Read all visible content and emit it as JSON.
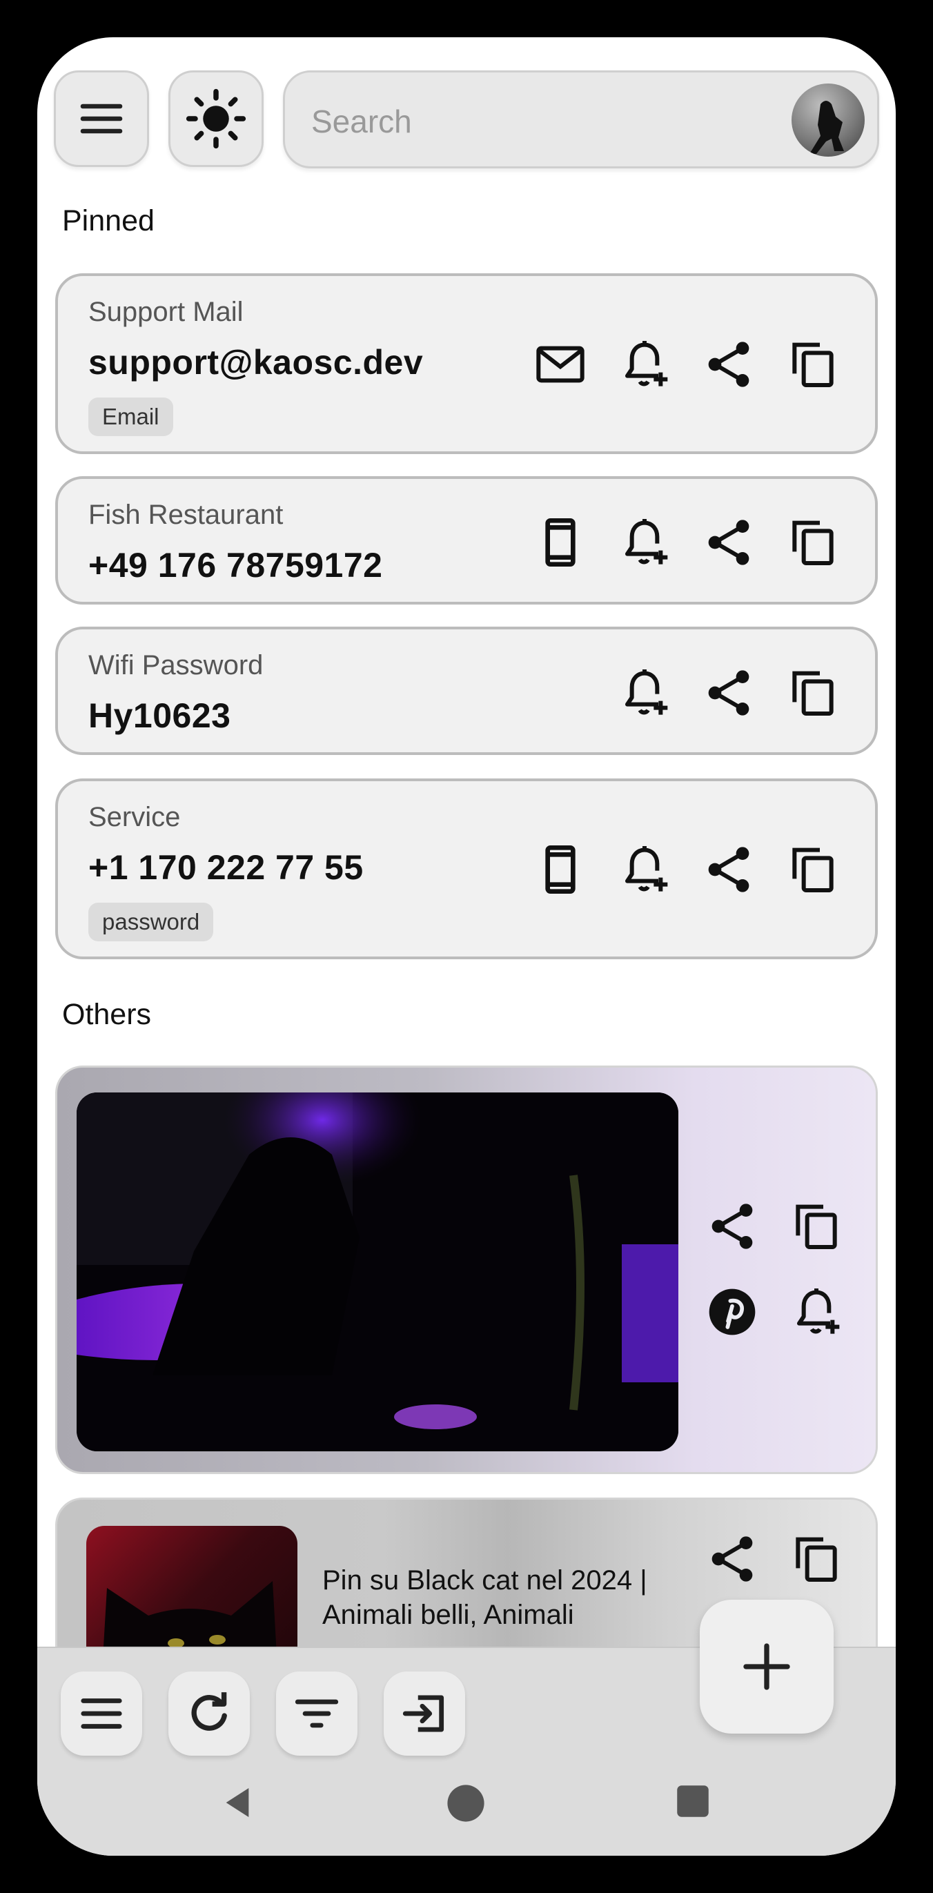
{
  "search": {
    "placeholder": "Search"
  },
  "sections": {
    "pinned": "Pinned",
    "others": "Others"
  },
  "pinned_items": [
    {
      "label": "Support Mail",
      "value": "support@kaosc.dev",
      "tag": "Email",
      "type_icon": "mail-icon"
    },
    {
      "label": "Fish Restaurant",
      "value": "+49 176 78759172",
      "tag": "",
      "type_icon": "phone-icon"
    },
    {
      "label": "Wifi Password",
      "value": "Hy10623",
      "tag": "",
      "type_icon": ""
    },
    {
      "label": "Service",
      "value": "+1 170 222 77 55",
      "tag": "password",
      "type_icon": "phone-icon"
    }
  ],
  "other_items": [
    {
      "kind": "image",
      "icons": [
        "share-icon",
        "copy-icon",
        "pinterest-icon",
        "add-reminder-icon"
      ]
    },
    {
      "kind": "link",
      "title": "Pin su Black cat nel 2024 | Animali belli, Animali"
    }
  ],
  "bottom_bar": {
    "buttons": [
      "menu-icon",
      "refresh-icon",
      "filter-icon",
      "import-icon"
    ],
    "fab": "add-icon"
  },
  "colors": {
    "card_bg": "#f1f1f1",
    "card_border": "#bcbcbc",
    "bar_bg": "#dcdcdc",
    "accent_purple": "#7a1cff"
  }
}
